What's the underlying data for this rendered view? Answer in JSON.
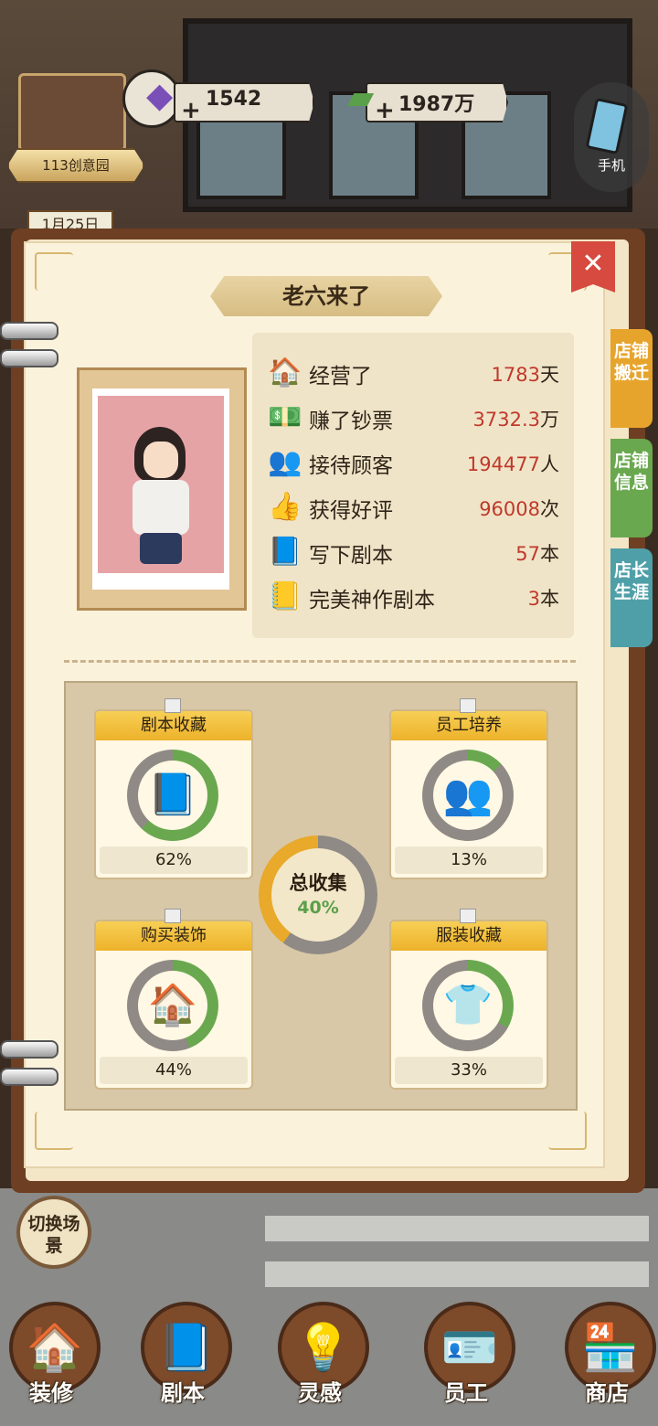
{
  "hud": {
    "store_name": "113创意园",
    "gems": "1542",
    "money": "1987万",
    "phone_label": "手机",
    "date": "1月25日"
  },
  "panel": {
    "title": "老六来了",
    "close_symbol": "✕",
    "side_tabs": [
      "店铺搬迁",
      "店铺信息",
      "店长生涯"
    ],
    "side_tab_colors": [
      "#e7a42c",
      "#6aa84f",
      "#4f9fa8"
    ]
  },
  "stats": [
    {
      "icon": "shop-icon",
      "glyph": "🏠",
      "label": "经营了",
      "value": "1783",
      "unit": "天"
    },
    {
      "icon": "cash-icon",
      "glyph": "💵",
      "label": "赚了钞票",
      "value": "3732.3",
      "unit": "万"
    },
    {
      "icon": "customers-icon",
      "glyph": "👥",
      "label": "接待顾客",
      "value": "194477",
      "unit": "人"
    },
    {
      "icon": "thumbs-up-icon",
      "glyph": "👍",
      "label": "获得好评",
      "value": "96008",
      "unit": "次"
    },
    {
      "icon": "script-book-icon",
      "glyph": "📘",
      "label": "写下剧本",
      "value": "57",
      "unit": "本"
    },
    {
      "icon": "golden-script-icon",
      "glyph": "📒",
      "label": "完美神作剧本",
      "value": "3",
      "unit": "本"
    }
  ],
  "collection": {
    "total_label": "总收集",
    "total_value": "40%",
    "total_fraction": 0.4,
    "cards": [
      {
        "title": "剧本收藏",
        "value": "62%",
        "fraction": 0.62,
        "glyph": "📘",
        "icon": "script-book-icon"
      },
      {
        "title": "员工培养",
        "value": "13%",
        "fraction": 0.13,
        "glyph": "👥",
        "icon": "staff-icon"
      },
      {
        "title": "购买装饰",
        "value": "44%",
        "fraction": 0.44,
        "glyph": "🏠",
        "icon": "decor-house-icon"
      },
      {
        "title": "服装收藏",
        "value": "33%",
        "fraction": 0.33,
        "glyph": "👕",
        "icon": "clothing-icon"
      }
    ]
  },
  "bottom": {
    "switch_scene": "切换场景",
    "nav": [
      {
        "label": "装修",
        "glyph": "🏠"
      },
      {
        "label": "剧本",
        "glyph": "📘"
      },
      {
        "label": "灵感",
        "glyph": "💡"
      },
      {
        "label": "员工",
        "glyph": "🪪"
      },
      {
        "label": "商店",
        "glyph": "🏪"
      }
    ]
  },
  "colors": {
    "ring_progress": "#e9a92a",
    "ring_track": "#8f8a85",
    "ring_green": "#6aa84f",
    "accent_red": "#c0392b"
  }
}
